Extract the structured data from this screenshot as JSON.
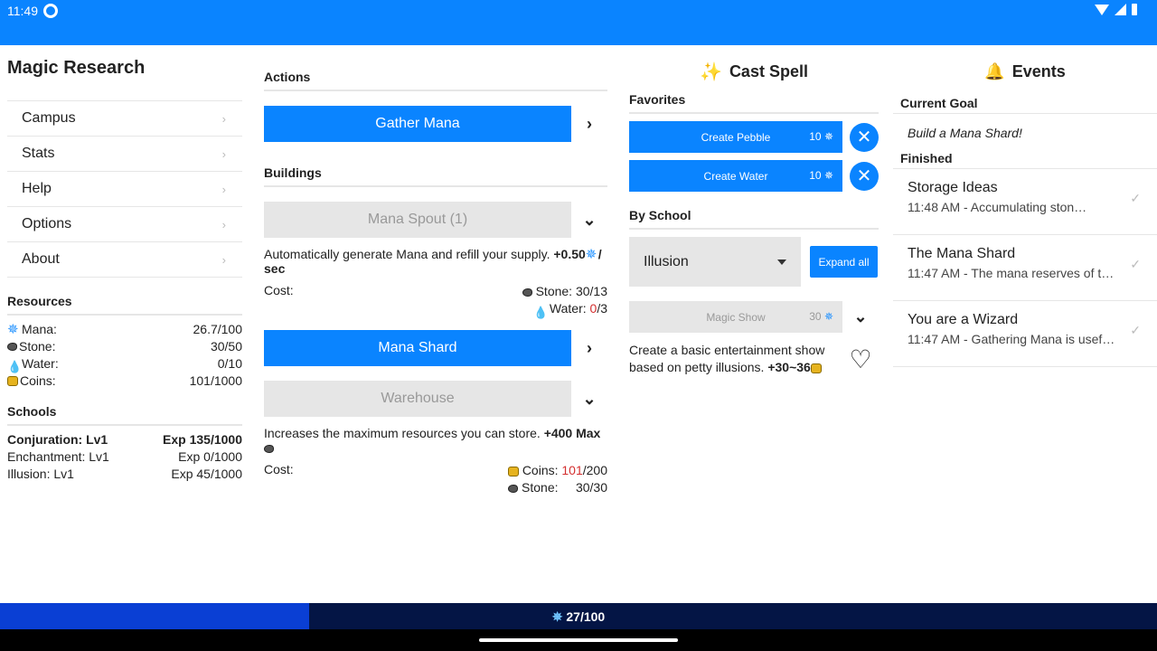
{
  "status": {
    "time": "11:49"
  },
  "app": {
    "title": "Magic Research"
  },
  "menu": [
    {
      "label": "Campus"
    },
    {
      "label": "Stats"
    },
    {
      "label": "Help"
    },
    {
      "label": "Options"
    },
    {
      "label": "About"
    }
  ],
  "resources": {
    "heading": "Resources",
    "items": [
      {
        "label": "Mana:",
        "value": "26.7/100",
        "icon": "mana-icon"
      },
      {
        "label": "Stone:",
        "value": "30/50",
        "icon": "stone-icon"
      },
      {
        "label": "Water:",
        "value": "0/10",
        "icon": "water-icon"
      },
      {
        "label": "Coins:",
        "value": "101/1000",
        "icon": "coin-icon"
      }
    ]
  },
  "schools": {
    "heading": "Schools",
    "items": [
      {
        "name": "Conjuration: Lv1",
        "exp": "Exp 135/1000",
        "bold": true
      },
      {
        "name": "Enchantment: Lv1",
        "exp": "Exp 0/1000",
        "bold": false
      },
      {
        "name": "Illusion: Lv1",
        "exp": "Exp 45/1000",
        "bold": false
      }
    ]
  },
  "actions": {
    "heading": "Actions",
    "gather": "Gather Mana"
  },
  "buildings": {
    "heading": "Buildings",
    "spout": {
      "label": "Mana Spout (1)",
      "desc_pre": "Automatically generate Mana and refill your supply. ",
      "desc_bold": "+0.50",
      "desc_bold2": "/ sec",
      "cost_label": "Cost:",
      "cost1": "Stone: 30/13",
      "cost2_pre": "Water: ",
      "cost2_red": "0",
      "cost2_post": "/3"
    },
    "shard": "Mana Shard",
    "warehouse": {
      "label": "Warehouse",
      "desc_pre": "Increases the maximum resources you can store. ",
      "desc_bold": "+400 Max",
      "cost_label": "Cost:",
      "cost1_pre": "Coins: ",
      "cost1_red": "101",
      "cost1_post": "/200",
      "cost2": "Stone:     30/30"
    }
  },
  "cast": {
    "heading": "Cast Spell",
    "favorites_heading": "Favorites",
    "favorites": [
      {
        "label": "Create Pebble",
        "cost": "10"
      },
      {
        "label": "Create Water",
        "cost": "10"
      }
    ],
    "by_school": "By School",
    "selected_school": "Illusion",
    "expand_all": "Expand all",
    "spell": {
      "label": "Magic Show",
      "cost": "30"
    },
    "spell_desc_pre": "Create a basic entertainment show based on petty illusions. ",
    "spell_desc_bold": "+30~36"
  },
  "events": {
    "heading": "Events",
    "goal_heading": "Current Goal",
    "goal": "Build a Mana Shard!",
    "finished_heading": "Finished",
    "items": [
      {
        "title": "Storage Ideas",
        "sub": "11:48 AM - Accumulating ston…"
      },
      {
        "title": "The Mana Shard",
        "sub": "11:47 AM - The mana reserves of th…"
      },
      {
        "title": "You are a Wizard",
        "sub": "11:47 AM - Gathering Mana is usef…"
      }
    ]
  },
  "footer": {
    "mana": "27/100",
    "fill_fraction": 0.267
  },
  "colors": {
    "accent": "#0a84ff",
    "footer_bg": "#041545",
    "footer_fill": "#0a3fd4",
    "warn": "#d32f2f"
  }
}
